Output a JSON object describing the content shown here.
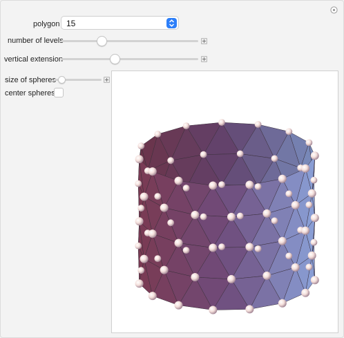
{
  "controls": {
    "polygon": {
      "label": "polygon",
      "selected": "15"
    },
    "levels": {
      "label": "number of levels",
      "value": 0.28
    },
    "vertical": {
      "label": "vertical extension",
      "value": 0.38
    },
    "sphere_size": {
      "label": "size of spheres",
      "value": 0.1
    },
    "center_spheres": {
      "label": "center spheres",
      "checked": false
    }
  },
  "colors": {
    "band_blue": "#8aa1d8",
    "band_purple": "#6f4c7c",
    "band_maroon": "#7a3a52",
    "accent": "#2d7ff9",
    "sphere": "#f2dcd8"
  },
  "icons": {
    "reset": "reset-icon",
    "select_arrow": "updown-chevron-icon",
    "plus": "plus-icon"
  }
}
